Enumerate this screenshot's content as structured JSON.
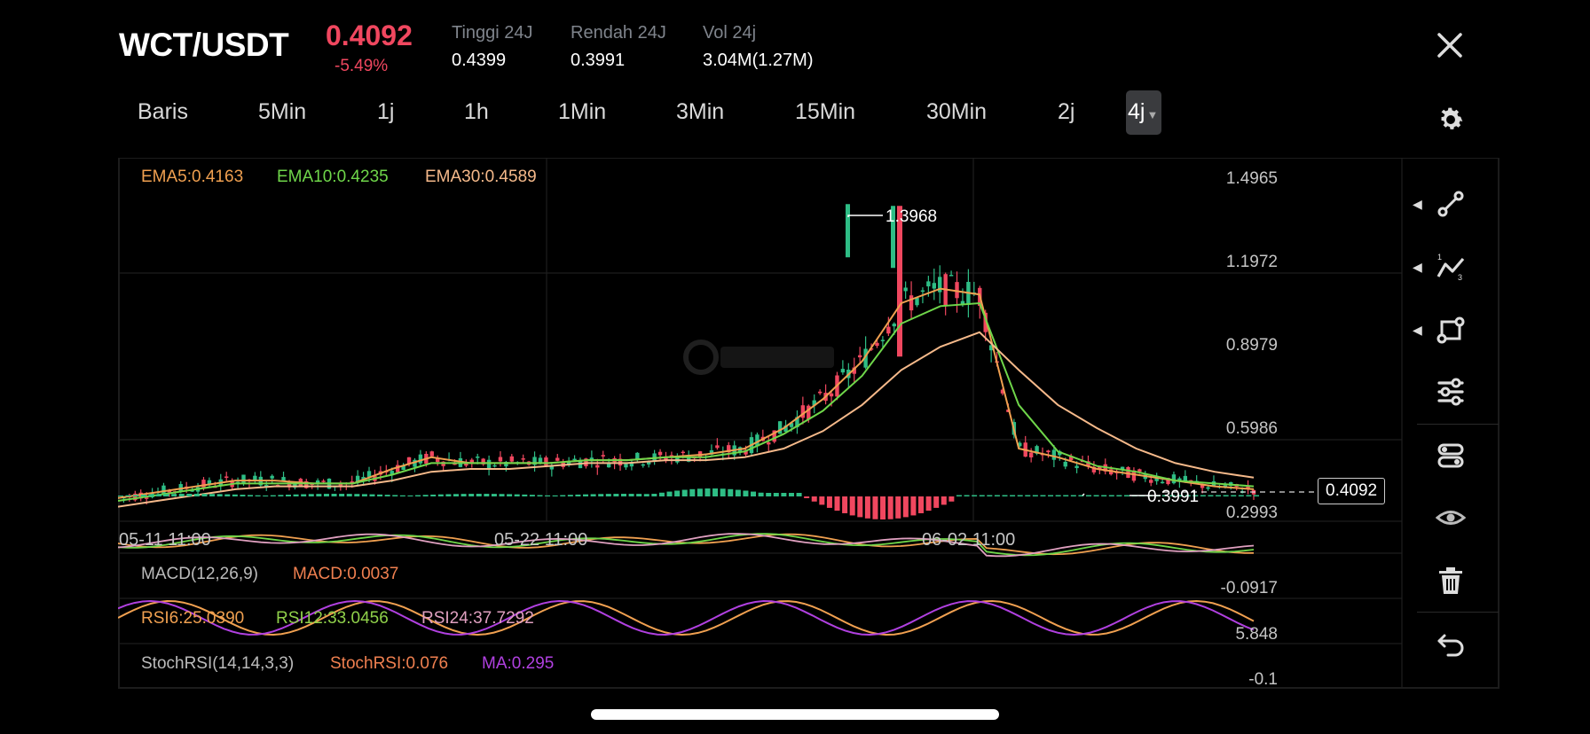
{
  "header": {
    "pair": "WCT/USDT",
    "price": "0.4092",
    "change": "-5.49%",
    "stats": [
      {
        "label": "Tinggi 24J",
        "value": "0.4399"
      },
      {
        "label": "Rendah 24J",
        "value": "0.3991"
      },
      {
        "label": "Vol 24j",
        "value": "3.04M(1.27M)"
      }
    ]
  },
  "tabs": [
    "Baris",
    "5Min",
    "1j",
    "1h",
    "1Min",
    "3Min",
    "15Min",
    "30Min",
    "2j",
    "4j"
  ],
  "active_tab": "4j",
  "ema": {
    "ema5": "EMA5:0.4163",
    "ema10": "EMA10:0.4235",
    "ema30": "EMA30:0.4589"
  },
  "price_axis": [
    "1.4965",
    "1.1972",
    "0.8979",
    "0.5986",
    "0.2993"
  ],
  "peak_label": "1.3968",
  "low_label": "0.3991",
  "current_price_tag": "0.4092",
  "date_labels": [
    "05-11 11:00",
    "05-22 11:00",
    "06-02 11:00"
  ],
  "macd": {
    "title": "MACD(12,26,9)",
    "value": "MACD:0.0037",
    "axis": "-0.0917"
  },
  "rsi": {
    "rsi6": "RSI6:25.0390",
    "rsi12": "RSI12:33.0456",
    "rsi24": "RSI24:37.7292",
    "axis": "5.848"
  },
  "stoch": {
    "title": "StochRSI(14,14,3,3)",
    "value": "StochRSI:0.076",
    "ma": "MA:0.295",
    "axis": "-0.1"
  },
  "sidebar_icons": [
    "line-tool-icon",
    "trend-tool-icon",
    "shape-tool-icon",
    "settings-sliders-icon",
    "indicator-icon",
    "eye-icon",
    "trash-icon",
    "undo-icon"
  ],
  "colors": {
    "up": "#2ebd85",
    "down": "#f0475f",
    "ema5": "#f0a050",
    "ema10": "#6fd64a",
    "ema30": "#f5b98a",
    "stoch_ma": "#b040e0"
  },
  "chart_data": {
    "type": "candlestick",
    "ylim": [
      0.2993,
      1.4965
    ],
    "x_labels": [
      "05-11 11:00",
      "05-22 11:00",
      "06-02 11:00"
    ],
    "series": [
      {
        "name": "EMA5",
        "values": [
          0.38,
          0.4,
          0.42,
          0.44,
          0.44,
          0.43,
          0.43,
          0.48,
          0.52,
          0.5,
          0.5,
          0.5,
          0.51,
          0.51,
          0.52,
          0.53,
          0.55,
          0.62,
          0.72,
          0.85,
          1.05,
          1.1,
          1.08,
          0.55,
          0.52,
          0.48,
          0.46,
          0.44,
          0.42,
          0.41
        ]
      },
      {
        "name": "EMA10",
        "values": [
          0.37,
          0.39,
          0.41,
          0.43,
          0.43,
          0.43,
          0.43,
          0.46,
          0.5,
          0.5,
          0.5,
          0.5,
          0.51,
          0.51,
          0.52,
          0.52,
          0.54,
          0.6,
          0.68,
          0.8,
          0.98,
          1.04,
          1.05,
          0.7,
          0.54,
          0.49,
          0.47,
          0.44,
          0.43,
          0.42
        ]
      },
      {
        "name": "EMA30",
        "values": [
          0.35,
          0.37,
          0.39,
          0.41,
          0.42,
          0.42,
          0.42,
          0.44,
          0.47,
          0.48,
          0.48,
          0.49,
          0.5,
          0.5,
          0.51,
          0.51,
          0.52,
          0.55,
          0.61,
          0.7,
          0.82,
          0.9,
          0.95,
          0.82,
          0.7,
          0.62,
          0.55,
          0.5,
          0.47,
          0.45
        ]
      }
    ],
    "peak": 1.3968,
    "low": 0.3991,
    "last": 0.4092
  }
}
